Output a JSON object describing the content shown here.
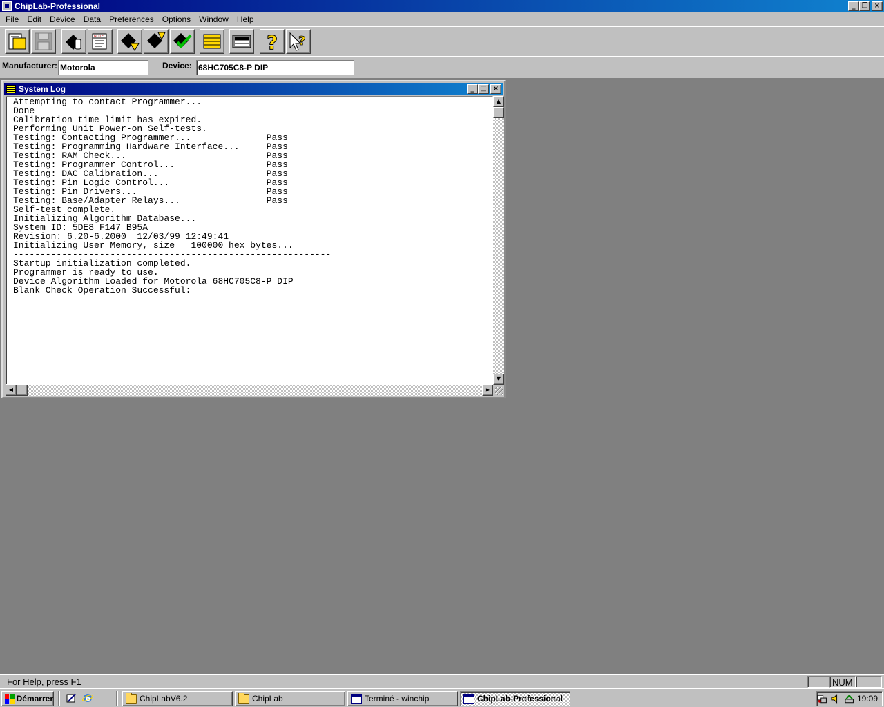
{
  "app": {
    "title": "ChipLab-Professional"
  },
  "menu": [
    "File",
    "Edit",
    "Device",
    "Data",
    "Preferences",
    "Options",
    "Window",
    "Help"
  ],
  "toolbar": {
    "buttons": [
      "open-file-icon",
      "save-disk-icon",
      "select-chip-icon",
      "note-icon",
      "read-device-icon",
      "program-device-icon",
      "verify-device-icon",
      "buffer-icon",
      "keyboard-editor-icon",
      "help-icon",
      "context-help-icon"
    ]
  },
  "device_bar": {
    "manufacturer_label": "Manufacturer:",
    "manufacturer_value": "Motorola",
    "device_label": "Device:",
    "device_value": "68HC705C8-P DIP"
  },
  "system_log": {
    "title": "System Log",
    "lines": [
      "Attempting to contact Programmer...",
      "Done",
      "Calibration time limit has expired.",
      "Performing Unit Power-on Self-tests.",
      "Testing: Contacting Programmer...              Pass",
      "Testing: Programming Hardware Interface...     Pass",
      "Testing: RAM Check...                          Pass",
      "Testing: Programmer Control...                 Pass",
      "Testing: DAC Calibration...                    Pass",
      "Testing: Pin Logic Control...                  Pass",
      "Testing: Pin Drivers...                        Pass",
      "Testing: Base/Adapter Relays...                Pass",
      "Self-test complete.",
      "Initializing Algorithm Database...",
      "System ID: 5DE8 F147 B95A",
      "Revision: 6.20-6.2000  12/03/99 12:49:41",
      "Initializing User Memory, size = 100000 hex bytes...",
      "-----------------------------------------------------------",
      "Startup initialization completed.",
      "Programmer is ready to use.",
      "Device Algorithm Loaded for Motorola 68HC705C8-P DIP",
      "Blank Check Operation Successful:"
    ]
  },
  "status": {
    "help_text": "For Help, press F1",
    "num": "NUM"
  },
  "taskbar": {
    "start_label": "Démarrer",
    "tasks": [
      {
        "label": "ChipLabV6.2",
        "icon": "folder-icon"
      },
      {
        "label": "ChipLab",
        "icon": "folder-icon"
      },
      {
        "label": "Terminé - winchip",
        "icon": "app-window-icon"
      },
      {
        "label": "ChipLab-Professional",
        "icon": "app-window-icon",
        "active": true
      }
    ],
    "clock": "19:09"
  }
}
